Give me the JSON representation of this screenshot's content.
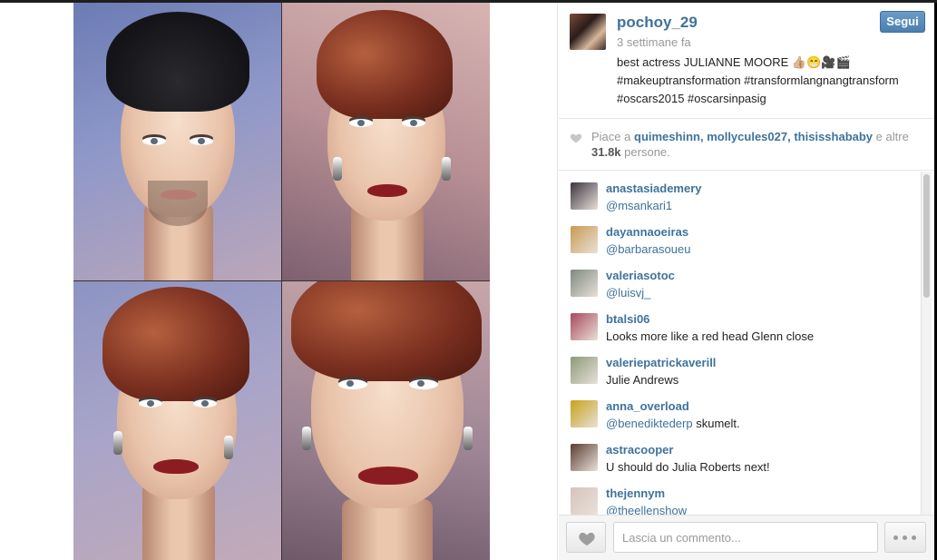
{
  "post": {
    "username": "pochoy_29",
    "time": "3 settimane fa",
    "follow_label": "Segui",
    "caption_line1": "best actress JULIANNE MOORE 👍🏼😁🎥🎬",
    "caption_line2": "#makeuptransformation #transformlangnangtransform",
    "caption_line3": "#oscars2015 #oscarsinpasig"
  },
  "likes": {
    "prefix": "Piace a",
    "user1": "quimeshinn",
    "sep1": ",",
    "user2": "mollycules027",
    "sep2": ",",
    "user3": "thisisshababy",
    "suffix_and": "e altre",
    "count": "31.8k",
    "suffix": "persone."
  },
  "comments": [
    {
      "user": "anastasiademery",
      "text": "",
      "mention": "@msankari1",
      "avatar_color": "#3b3440"
    },
    {
      "user": "dayannaoeiras",
      "text": "",
      "mention": "@barbarasoueu",
      "avatar_color": "#c99a52"
    },
    {
      "user": "valeriasotoc",
      "text": "",
      "mention": "@luisvj_",
      "avatar_color": "#7d8a80"
    },
    {
      "user": "btalsi06",
      "text": "Looks more like a red head Glenn close",
      "mention": "",
      "avatar_color": "#a8485a"
    },
    {
      "user": "valeriepatrickaverill",
      "text": "Julie Andrews",
      "mention": "",
      "avatar_color": "#8d9a7a"
    },
    {
      "user": "anna_overload",
      "text": " skumelt.",
      "mention": "@benediktederp",
      "avatar_color": "#c8a21a"
    },
    {
      "user": "astracooper",
      "text": "U should do Julia Roberts next!",
      "mention": "",
      "avatar_color": "#5a3d32"
    },
    {
      "user": "thejennym",
      "text": "",
      "mention": "@theellenshow",
      "avatar_color": "#d6c4bc"
    }
  ],
  "footer": {
    "comment_placeholder": "Lascia un commento...",
    "like_icon": "heart-icon",
    "more_icon": "ellipsis-icon"
  },
  "colors": {
    "link": "#3f729b",
    "follow_button": "#4b7fae",
    "muted_text": "#999999"
  }
}
